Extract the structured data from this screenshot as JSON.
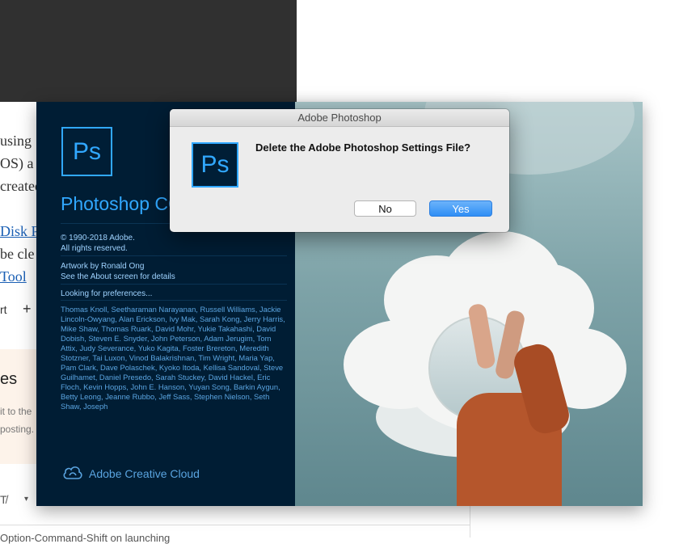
{
  "background_doc": {
    "line1": "using",
    "line2": "OS) a",
    "line3": "created",
    "link1": "Disk P",
    "line4": "be cle",
    "link2": "Tool",
    "toolbar_text": "rt",
    "toolbar_plus": "+",
    "section_title": "es",
    "section_line1": "it to the",
    "section_line2": "posting.",
    "footer_text": "Option-Command-Shift on launching"
  },
  "splash": {
    "logo_text": "Ps",
    "product_title": "Photoshop CC",
    "copyright": "© 1990-2018 Adobe.",
    "rights": "All rights reserved.",
    "artwork": "Artwork by Ronald Ong",
    "about": "See the About screen for details",
    "status": "Looking for preferences...",
    "credits": "Thomas Knoll, Seetharaman Narayanan, Russell Williams, Jackie Lincoln-Owyang, Alan Erickson, Ivy Mak, Sarah Kong, Jerry Harris, Mike Shaw, Thomas Ruark, David Mohr, Yukie Takahashi, David Dobish, Steven E. Snyder, John Peterson, Adam Jerugim, Tom Attix, Judy Severance, Yuko Kagita, Foster Brereton, Meredith Stotzner, Tai Luxon, Vinod Balakrishnan, Tim Wright, Maria Yap, Pam Clark, Dave Polaschek, Kyoko Itoda, Kellisa Sandoval, Steve Guilhamet, Daniel Presedo, Sarah Stuckey, David Hackel, Eric Floch, Kevin Hopps, John E. Hanson, Yuyan Song, Barkin Aygun, Betty Leong, Jeanne Rubbo, Jeff Sass, Stephen Nielson, Seth Shaw, Joseph",
    "creative_cloud": "Adobe Creative Cloud"
  },
  "dialog": {
    "title": "Adobe Photoshop",
    "icon_text": "Ps",
    "message": "Delete the Adobe Photoshop Settings File?",
    "no_label": "No",
    "yes_label": "Yes"
  },
  "colors": {
    "ps_blue": "#31a8ff",
    "ps_navy": "#001e36",
    "yes_button": "#2f8ef5"
  }
}
